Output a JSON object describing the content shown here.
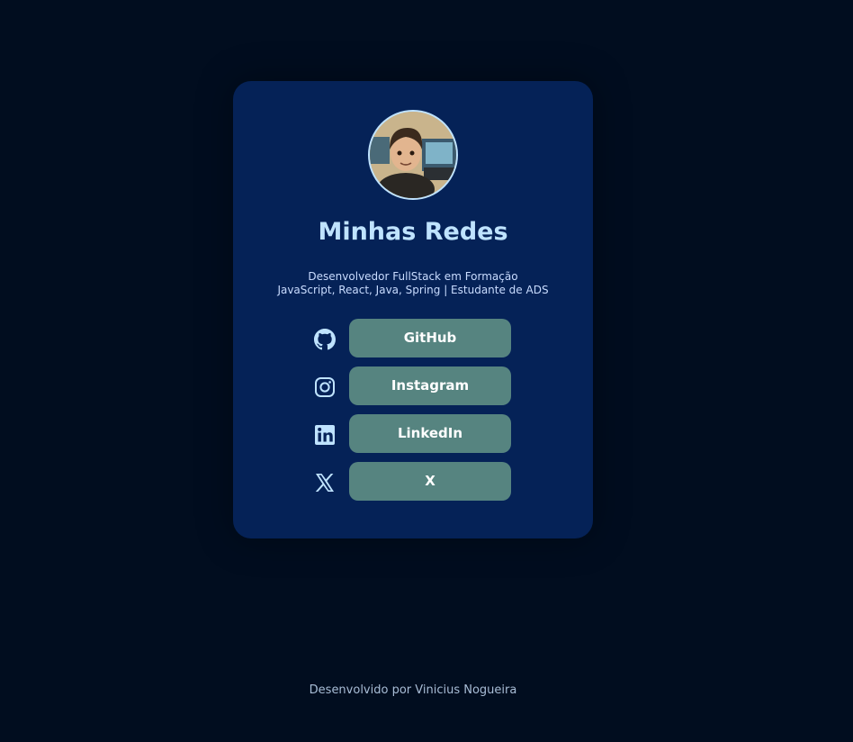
{
  "profile": {
    "title": "Minhas Redes",
    "description_line1": "Desenvolvedor FullStack em Formação",
    "description_line2": "JavaScript, React, Java, Spring | Estudante de ADS"
  },
  "links": [
    {
      "label": "GitHub",
      "icon": "github-icon"
    },
    {
      "label": "Instagram",
      "icon": "instagram-icon"
    },
    {
      "label": "LinkedIn",
      "icon": "linkedin-icon"
    },
    {
      "label": "X",
      "icon": "x-icon"
    }
  ],
  "footer": {
    "text": "Desenvolvido por Vinicius Nogueira"
  },
  "colors": {
    "background": "#010d1f",
    "card": "#052257",
    "button": "#568480",
    "title": "#bfe3ff"
  }
}
